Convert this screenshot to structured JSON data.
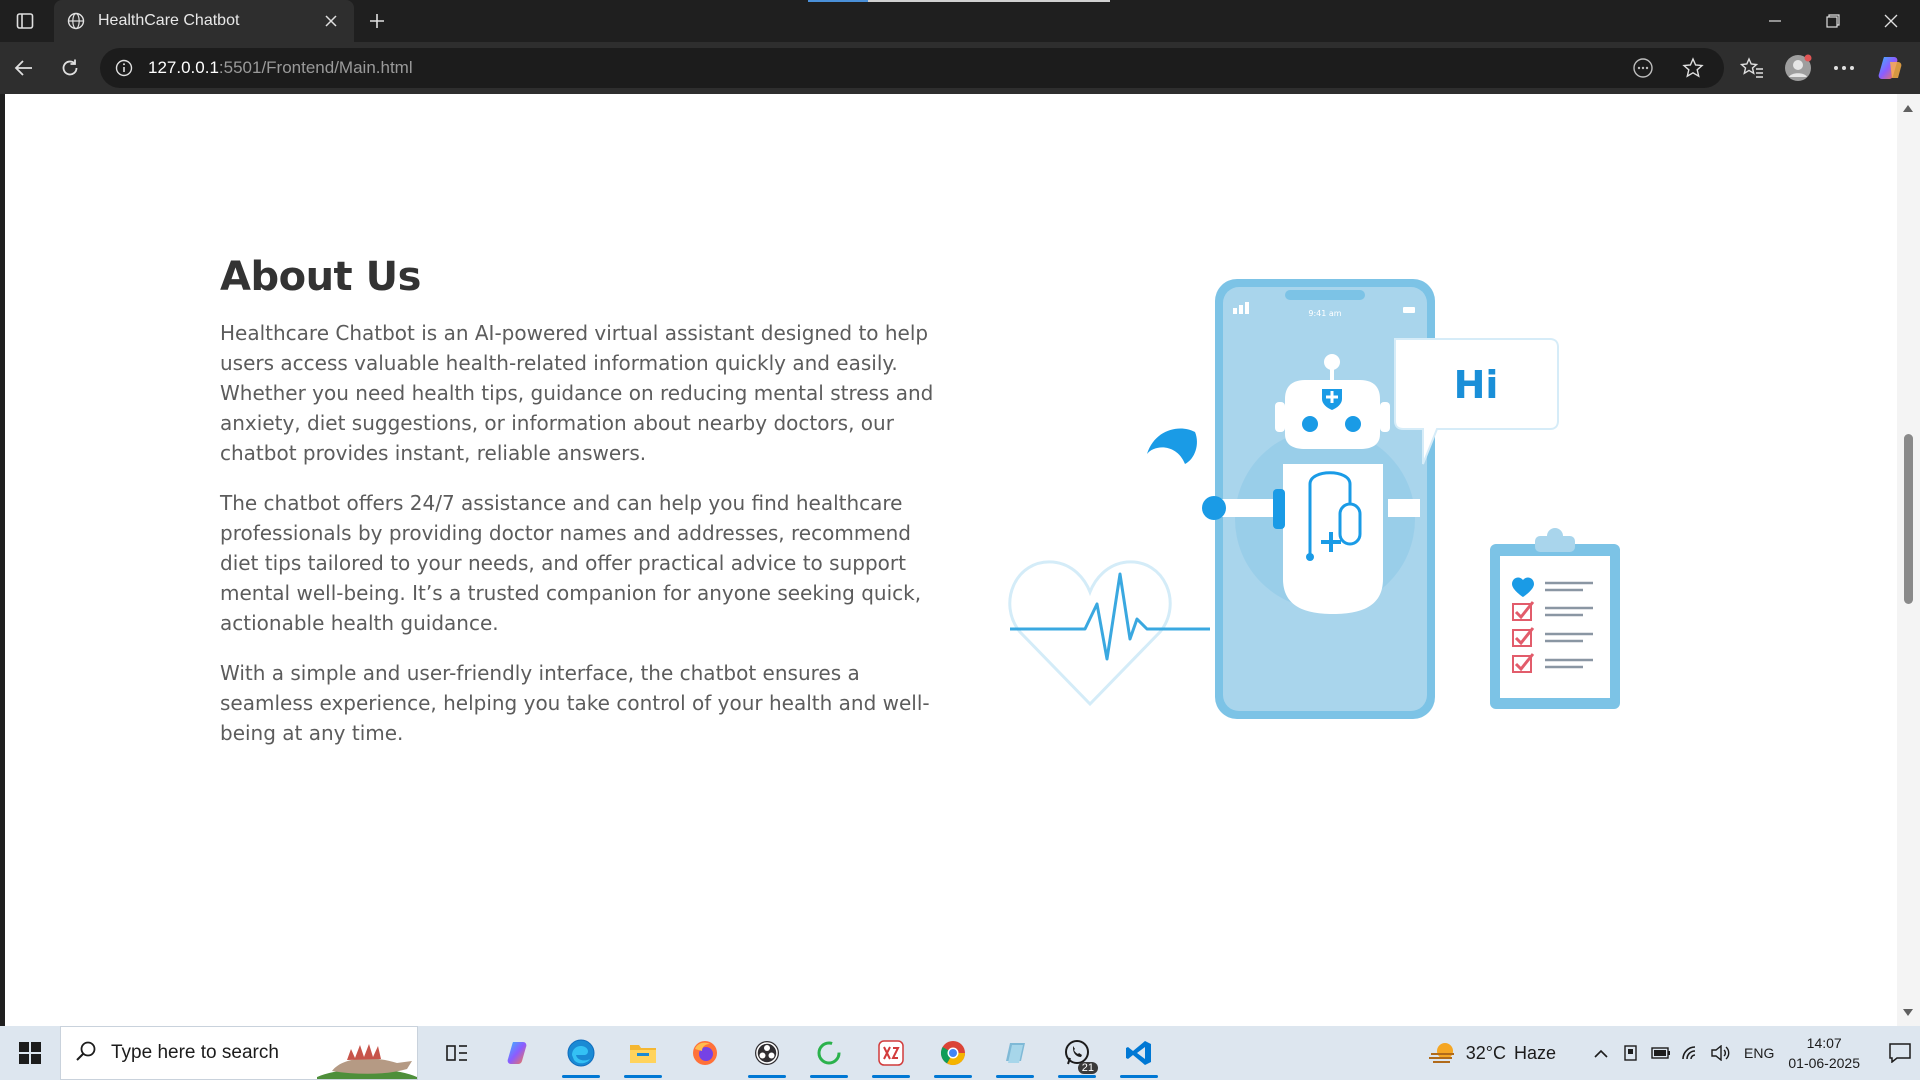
{
  "browser": {
    "tab_title": "HealthCare Chatbot",
    "url_host": "127.0.0.1",
    "url_rest": ":5501/Frontend/Main.html"
  },
  "page": {
    "heading": "About Us",
    "paragraphs": [
      "Healthcare Chatbot is an AI-powered virtual assistant designed to help users access valuable health-related information quickly and easily. Whether you need health tips, guidance on reducing mental stress and anxiety, diet suggestions, or information about nearby doctors, our chatbot provides instant, reliable answers.",
      "The chatbot offers 24/7 assistance and can help you find healthcare professionals by providing doctor names and addresses, recommend diet tips tailored to your needs, and offer practical advice to support mental well-being. It’s a trusted companion for anyone seeking quick, actionable health guidance.",
      "With a simple and user-friendly interface, the chatbot ensures a seamless experience, helping you take control of your health and well-being at any time."
    ],
    "illustration": {
      "speech_text": "Hi",
      "phone_status_time": "9:41 am"
    }
  },
  "taskbar": {
    "search_placeholder": "Type here to search",
    "weather_temp": "32°C",
    "weather_desc": "Haze",
    "lang": "ENG",
    "time": "14:07",
    "date": "01-06-2025",
    "whatsapp_badge": "21"
  },
  "colors": {
    "accent": "#1a9be6",
    "phone_screen": "#a9d5ec",
    "phone_frame": "#7cc3e6"
  }
}
